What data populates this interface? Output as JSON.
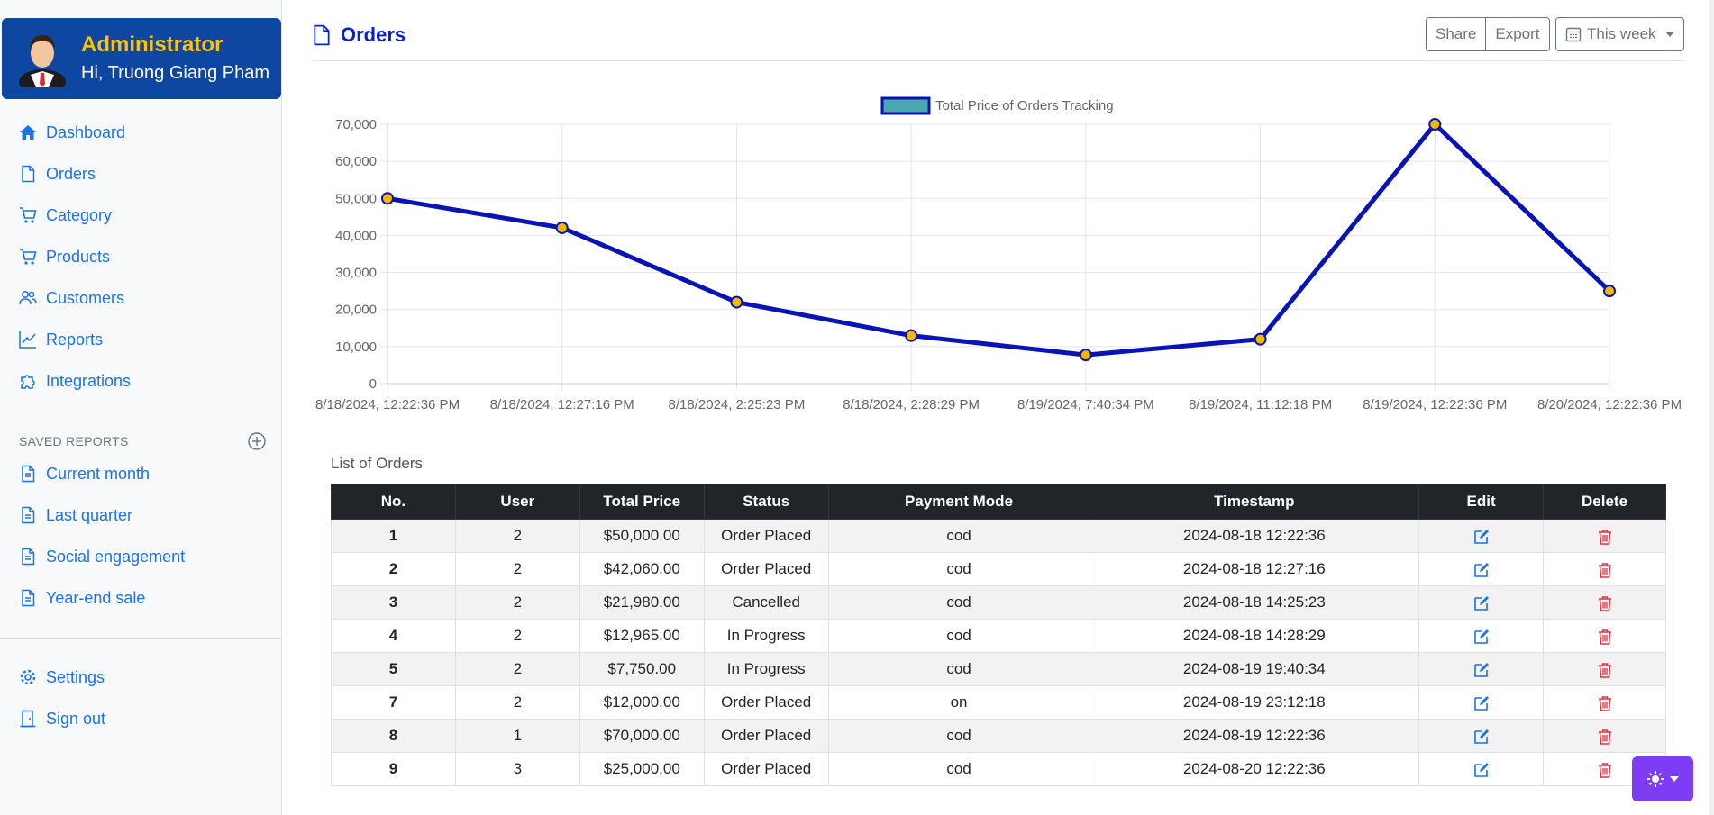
{
  "profile": {
    "role": "Administrator",
    "greeting": "Hi, Truong Giang Pham"
  },
  "nav": [
    {
      "label": "Dashboard",
      "icon": "home-icon"
    },
    {
      "label": "Orders",
      "icon": "file-icon"
    },
    {
      "label": "Category",
      "icon": "cart-icon"
    },
    {
      "label": "Products",
      "icon": "cart-icon"
    },
    {
      "label": "Customers",
      "icon": "users-icon"
    },
    {
      "label": "Reports",
      "icon": "chart-line-icon"
    },
    {
      "label": "Integrations",
      "icon": "puzzle-icon"
    }
  ],
  "saved_reports": {
    "heading": "SAVED REPORTS",
    "items": [
      "Current month",
      "Last quarter",
      "Social engagement",
      "Year-end sale"
    ]
  },
  "bottom_nav": [
    {
      "label": "Settings",
      "icon": "gear-icon"
    },
    {
      "label": "Sign out",
      "icon": "door-icon"
    }
  ],
  "header": {
    "title": "Orders",
    "share_label": "Share",
    "export_label": "Export",
    "period_label": "This week"
  },
  "colors": {
    "accent": "#1a73e8",
    "title": "#0a1fd6",
    "profile_bg": "#0d47a1",
    "line": "#0a14b4",
    "point": "#f5b800",
    "theme_button": "#7f3cf5"
  },
  "chart_data": {
    "type": "line",
    "legend": "Total Price of Orders Tracking",
    "legend_position": "top",
    "x": [
      "8/18/2024, 12:22:36 PM",
      "8/18/2024, 12:27:16 PM",
      "8/18/2024, 2:25:23 PM",
      "8/18/2024, 2:28:29 PM",
      "8/19/2024, 7:40:34 PM",
      "8/19/2024, 11:12:18 PM",
      "8/19/2024, 12:22:36 PM",
      "8/20/2024, 12:22:36 PM"
    ],
    "series": [
      {
        "name": "Total Price of Orders Tracking",
        "values": [
          50000,
          42060,
          21980,
          12965,
          7750,
          12000,
          70000,
          25000
        ]
      }
    ],
    "yticks": [
      "0",
      "10,000",
      "20,000",
      "30,000",
      "40,000",
      "50,000",
      "60,000",
      "70,000"
    ],
    "ylim": [
      0,
      70000
    ],
    "grid": true
  },
  "table": {
    "title": "List of Orders",
    "columns": [
      "No.",
      "User",
      "Total Price",
      "Status",
      "Payment Mode",
      "Timestamp",
      "Edit",
      "Delete"
    ],
    "rows": [
      [
        "1",
        "2",
        "$50,000.00",
        "Order Placed",
        "cod",
        "2024-08-18 12:22:36"
      ],
      [
        "2",
        "2",
        "$42,060.00",
        "Order Placed",
        "cod",
        "2024-08-18 12:27:16"
      ],
      [
        "3",
        "2",
        "$21,980.00",
        "Cancelled",
        "cod",
        "2024-08-18 14:25:23"
      ],
      [
        "4",
        "2",
        "$12,965.00",
        "In Progress",
        "cod",
        "2024-08-18 14:28:29"
      ],
      [
        "5",
        "2",
        "$7,750.00",
        "In Progress",
        "cod",
        "2024-08-19 19:40:34"
      ],
      [
        "7",
        "2",
        "$12,000.00",
        "Order Placed",
        "on",
        "2024-08-19 23:12:18"
      ],
      [
        "8",
        "1",
        "$70,000.00",
        "Order Placed",
        "cod",
        "2024-08-19 12:22:36"
      ],
      [
        "9",
        "3",
        "$25,000.00",
        "Order Placed",
        "cod",
        "2024-08-20 12:22:36"
      ]
    ]
  }
}
